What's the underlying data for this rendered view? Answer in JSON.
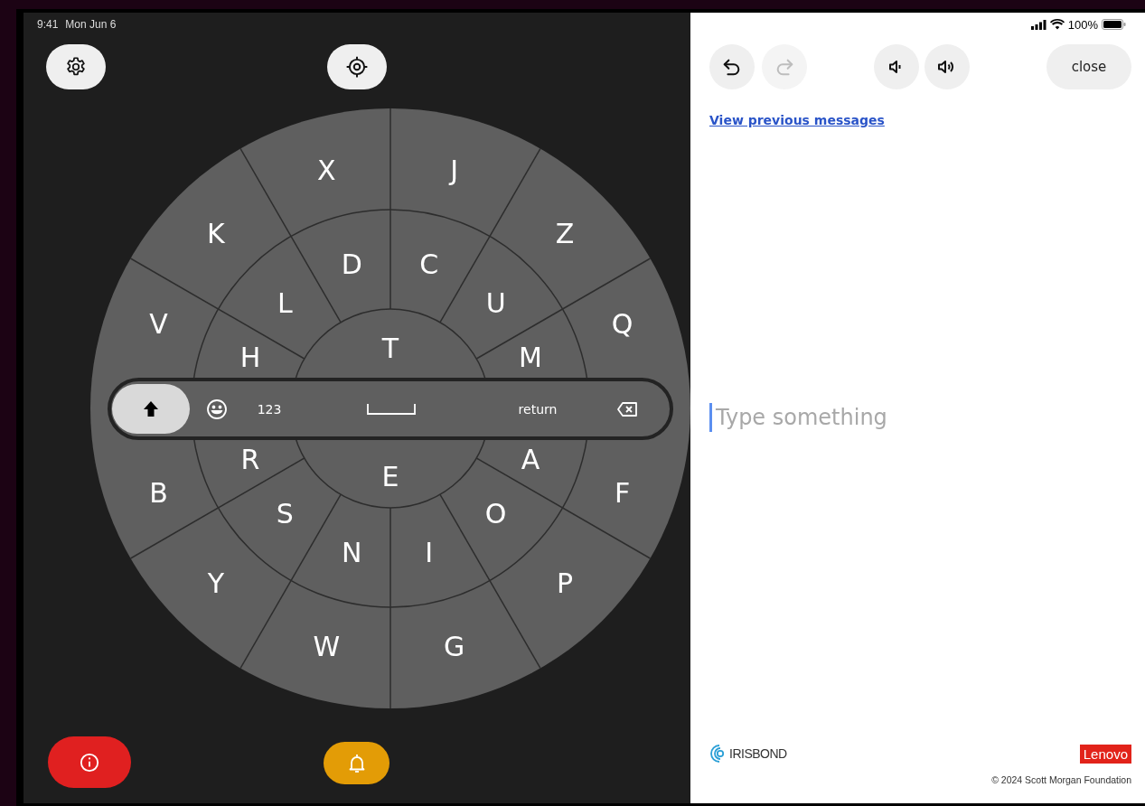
{
  "status_bar": {
    "time": "9:41",
    "date": "Mon Jun 6",
    "battery": "100%"
  },
  "left_toolbar": [
    {
      "kind": "settings"
    },
    {
      "kind": "recenter"
    }
  ],
  "keyboard": {
    "outer_ring": [
      "Q",
      "Z",
      "J",
      "X",
      "K",
      "V",
      "B",
      "Y",
      "W",
      "G",
      "P",
      "F"
    ],
    "middle_ring": [
      "M",
      "U",
      "C",
      "D",
      "L",
      "H",
      "R",
      "S",
      "N",
      "I",
      "O",
      "A"
    ],
    "inner": [
      "T",
      "E"
    ],
    "shift": {
      "on": true
    },
    "bar_keys": [
      {
        "kind": "emoji"
      },
      {
        "kind": "text",
        "label": "123"
      },
      {
        "kind": "space"
      },
      {
        "kind": "text",
        "label": "return"
      },
      {
        "kind": "backspace"
      }
    ]
  },
  "bottom_buttons": [
    {
      "kind": "info"
    },
    {
      "kind": "alert"
    }
  ],
  "right_toolbar": [
    {
      "kind": "undo",
      "disabled": false
    },
    {
      "kind": "redo",
      "disabled": true
    },
    {
      "kind": "volume-down",
      "disabled": false
    },
    {
      "kind": "volume-up",
      "disabled": false
    }
  ],
  "close_button": "close",
  "history_link": "View previous messages",
  "message": {
    "placeholder": "Type something"
  },
  "footer": {
    "partner_logo": "IRISBOND",
    "sponsor_logo": "Lenovo",
    "copyright": "© 2024 Scott Morgan Foundation"
  }
}
